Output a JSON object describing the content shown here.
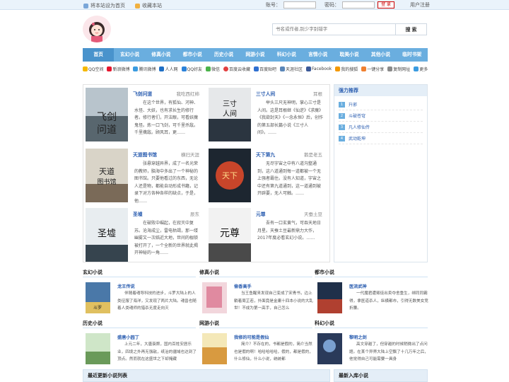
{
  "topbar": {
    "set_home": "将本站设为首页",
    "bookmark": "收藏本站",
    "account_label": "账号：",
    "password_label": "密码：",
    "login": "登 录",
    "register": "用户注册"
  },
  "search": {
    "placeholder": "书名或作者,别少字别错字",
    "button": "搜 索"
  },
  "nav": [
    "首页",
    "玄幻小说",
    "修真小说",
    "都市小说",
    "历史小说",
    "网游小说",
    "科幻小说",
    "言情小说",
    "耽美小说",
    "其他小说",
    "临时书架"
  ],
  "share": [
    "QQ空间",
    "新浪微博",
    "腾讯微博",
    "人人网",
    "QQ好友",
    "微信",
    "百度云收藏",
    "百度贴吧",
    "天涯社区",
    "Facebook",
    "我的搜狐",
    "一键分享",
    "复制网址",
    "更多"
  ],
  "featured": [
    {
      "title": "飞剑问道",
      "author": "我吃西红柿",
      "desc": "在这个世界，有狐仙、河神、水怪、大妖，也有求长生的修行者。修行者们，开法眼，可看妖魔鬼怪。炼一口飞剑，可千里杀敌。千里擒敌。顾风耳，更……"
    },
    {
      "title": "三寸人间",
      "author": "耳根",
      "desc": "举头三尺无神明，掌心三寸是人间。这是耳根继《仙逆》《求魔》《我欲封天》《一念永恒》后，创作的第五部长篇小说《三寸人间》。……"
    },
    {
      "title": "天道图书馆",
      "author": "横扫天涯",
      "desc": "张悬穿越异界，成了一名光荣的教师，脑海中多出了一个神秘的图书馆。只要他看过的东西，无论人还是物，都能自动形成书籍，记录下对方各种各样的缺点，于是，他……"
    },
    {
      "title": "天下第九",
      "author": "鹅是老五",
      "desc": "无尽宇宙之中有八道沟壑通到，这八道通到每一道都被一个无上强者霸住。没有人知道，宇宙之中还有第九道通到，这一道通到被开辟要，无人可触。……"
    },
    {
      "title": "圣墟",
      "author": "辰东",
      "desc": "在破败中崛起，在寂灭中复苏。沧海成尘，雷电枯竭，那一缕幽雾又一次临近大地，世间的枷锁被打开了，一个全新的世界就此揭开神秘的一角……"
    },
    {
      "title": "元尊",
      "author": "天蚕土豆",
      "desc": "吾有一口玄黄气，可吞天地日月星。天蚕土豆最新鼎力大作，2017年度必看玄幻小说。……"
    }
  ],
  "rank": {
    "title": "强力推荐",
    "items": [
      {
        "num": "1",
        "name": "升邪"
      },
      {
        "num": "2",
        "name": "斗破苍穹"
      },
      {
        "num": "3",
        "name": "凡人修仙传"
      },
      {
        "num": "4",
        "name": "武动乾坤"
      }
    ]
  },
  "categories": [
    {
      "head": "玄幻小说",
      "title": "龙王传说",
      "desc": "伴随着魂导科技的进步，斗罗大陆上的人类征服了海洋，又发现了两片大陆。魂兽也随着人类魂师的猎杀无度走向灭"
    },
    {
      "head": "修真小说",
      "title": "偷香高手",
      "desc": "当王鱼醒来发现自己变成了宋青书，边上躺着周芷若，外面竟是金庸十四本小说的大乱世！不成为第一高手，自己怎么"
    },
    {
      "head": "都市小说",
      "title": "医流武神",
      "desc": "一代魔君遭叛徒出卖夺舍重生，绑同同霸得，拿医道杀人，纵横都市，引得无数美女竞折腰。"
    },
    {
      "head": "历史小说",
      "title": "盛唐小园丁",
      "desc": "上元二年，大唐衰颓，国内百姓安居乐业，四境之外再无强敌，纸治的疆域也达到了顶点。然而就在这盛世之下却掩藏"
    },
    {
      "head": "网游小说",
      "title": "我修的可能是假仙",
      "desc": "简介？不存在的，书都是假的，简介当然也是假的啊！哈哈哈哈哈，假的，都是假的，什么修仙，什么小说，统统都"
    },
    {
      "head": "科幻小说",
      "title": "黎明之剑",
      "desc": "高文穿越了，但穿越的时候稍微出了点问题。在某个异界大陆上空飘了十几万年之后，他觉得自己可能需要一具身"
    }
  ],
  "bottom": {
    "left": "最近更新小说列表",
    "right": "最新入库小说"
  },
  "colors": {
    "nav": "#6aaedf",
    "nav_active": "#4993cc",
    "link": "#2a5db0",
    "login_red": "#cc0000"
  }
}
